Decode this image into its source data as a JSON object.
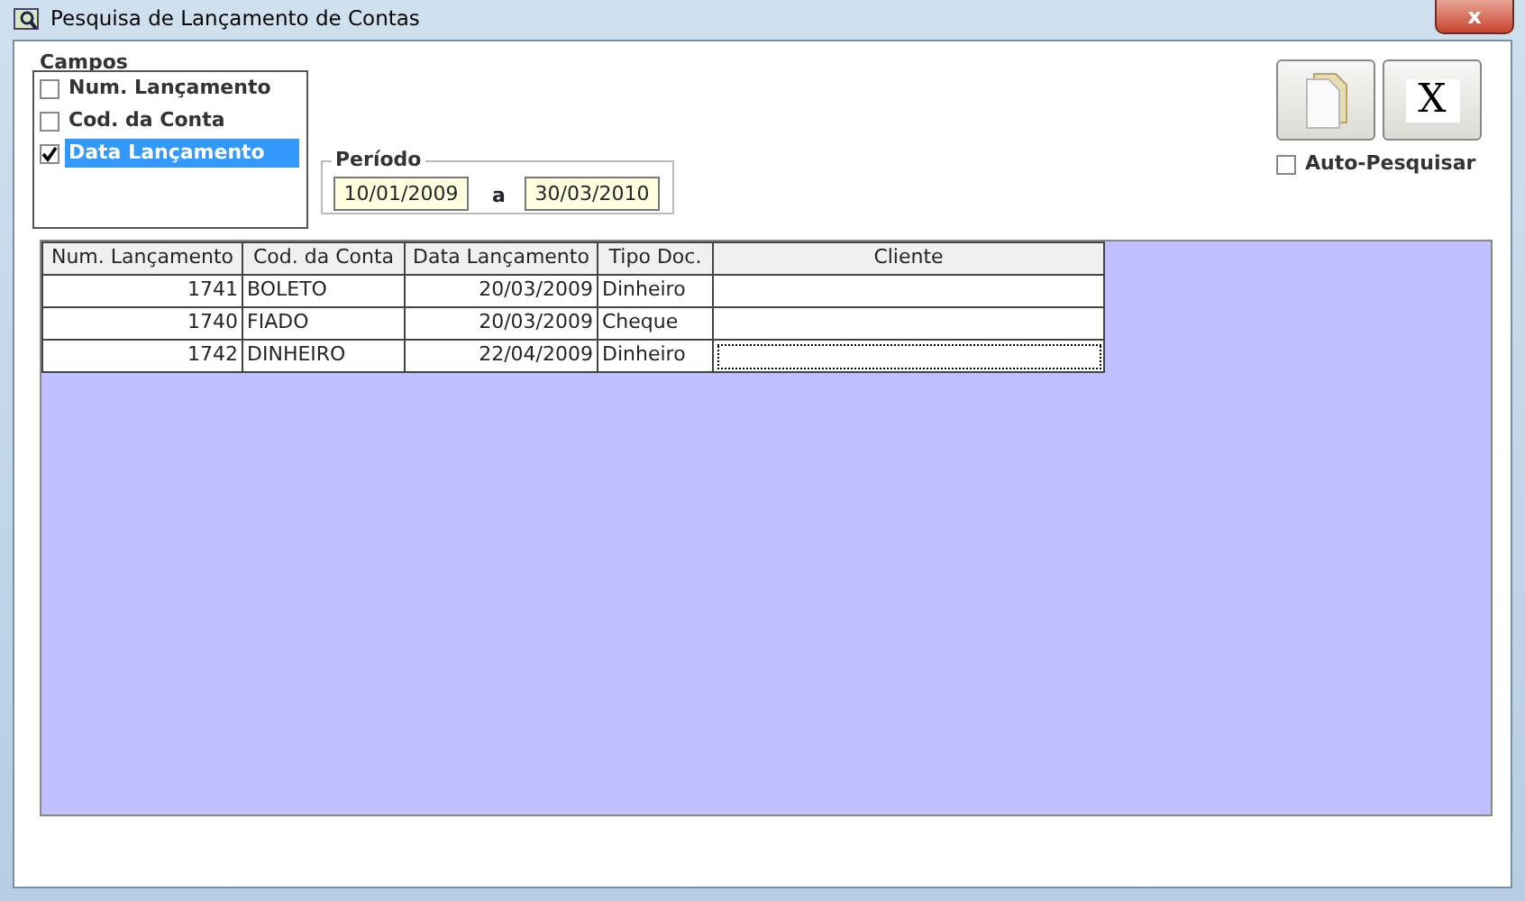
{
  "window": {
    "title": "Pesquisa de Lançamento de Contas",
    "close": "x"
  },
  "campos": {
    "label": "Campos",
    "items": [
      {
        "label": "Num. Lançamento",
        "checked": false,
        "selected": false
      },
      {
        "label": "Cod. da Conta",
        "checked": false,
        "selected": false
      },
      {
        "label": "Data Lançamento",
        "checked": true,
        "selected": true
      }
    ]
  },
  "periodo": {
    "label": "Período",
    "from": "10/01/2009",
    "separator": "a",
    "to": "30/03/2010"
  },
  "buttons": [
    {
      "kind": "document"
    },
    {
      "kind": "text",
      "label": "X"
    }
  ],
  "auto_pesquisar": {
    "label": "Auto-Pesquisar",
    "checked": false
  },
  "table": {
    "columns": [
      "Num. Lançamento",
      "Cod. da Conta",
      "Data Lançamento",
      "Tipo Doc.",
      "Cliente"
    ],
    "rows": [
      {
        "cells": [
          "1741",
          "BOLETO",
          "20/03/2009",
          "Dinheiro",
          ""
        ],
        "focused": false
      },
      {
        "cells": [
          "1740",
          "FIADO",
          "20/03/2009",
          "Cheque",
          ""
        ],
        "focused": false
      },
      {
        "cells": [
          "1742",
          "DINHEIRO",
          "22/04/2009",
          "Dinheiro",
          ""
        ],
        "focused": true
      }
    ]
  }
}
